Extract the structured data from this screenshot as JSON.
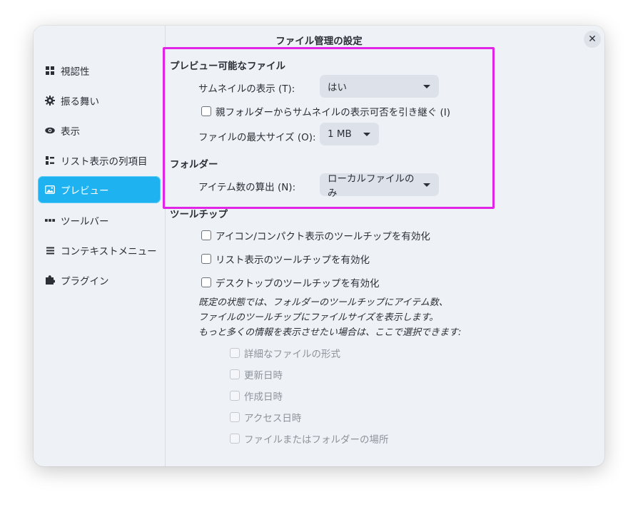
{
  "window": {
    "title": "ファイル管理の設定",
    "close_label": "✕"
  },
  "sidebar": {
    "items": [
      {
        "label": "視認性",
        "icon": "grid-icon"
      },
      {
        "label": "振る舞い",
        "icon": "gear-icon"
      },
      {
        "label": "表示",
        "icon": "eye-icon"
      },
      {
        "label": "リスト表示の列項目",
        "icon": "columns-icon"
      },
      {
        "label": "プレビュー",
        "icon": "image-icon",
        "active": true
      },
      {
        "label": "ツールバー",
        "icon": "dots-icon"
      },
      {
        "label": "コンテキストメニュー",
        "icon": "list-icon"
      },
      {
        "label": "プラグイン",
        "icon": "puzzle-icon"
      }
    ]
  },
  "preview": {
    "heading": "プレビュー可能なファイル",
    "thumbnail_label": "サムネイルの表示 (T):",
    "thumbnail_value": "はい",
    "inherit_label": "親フォルダーからサムネイルの表示可否を引き継ぐ (I)",
    "max_size_label": "ファイルの最大サイズ (O):",
    "max_size_value": "1 MB"
  },
  "folder": {
    "heading": "フォルダー",
    "count_label": "アイテム数の算出 (N):",
    "count_value": "ローカルファイルのみ"
  },
  "tooltip": {
    "heading": "ツールチップ",
    "icon_compact": "アイコン/コンパクト表示のツールチップを有効化",
    "list_view": "リスト表示のツールチップを有効化",
    "desktop": "デスクトップのツールチップを有効化",
    "note_line1": "既定の状態では、フォルダーのツールチップにアイテム数、",
    "note_line2": "ファイルのツールチップにファイルサイズを表示します。",
    "note_line3": "もっと多くの情報を表示させたい場合は、ここで選択できます:",
    "details": [
      "詳細なファイルの形式",
      "更新日時",
      "作成日時",
      "アクセス日時",
      "ファイルまたはフォルダーの場所"
    ]
  },
  "colors": {
    "accent": "#1eb3f0",
    "highlight": "#e025e6"
  }
}
